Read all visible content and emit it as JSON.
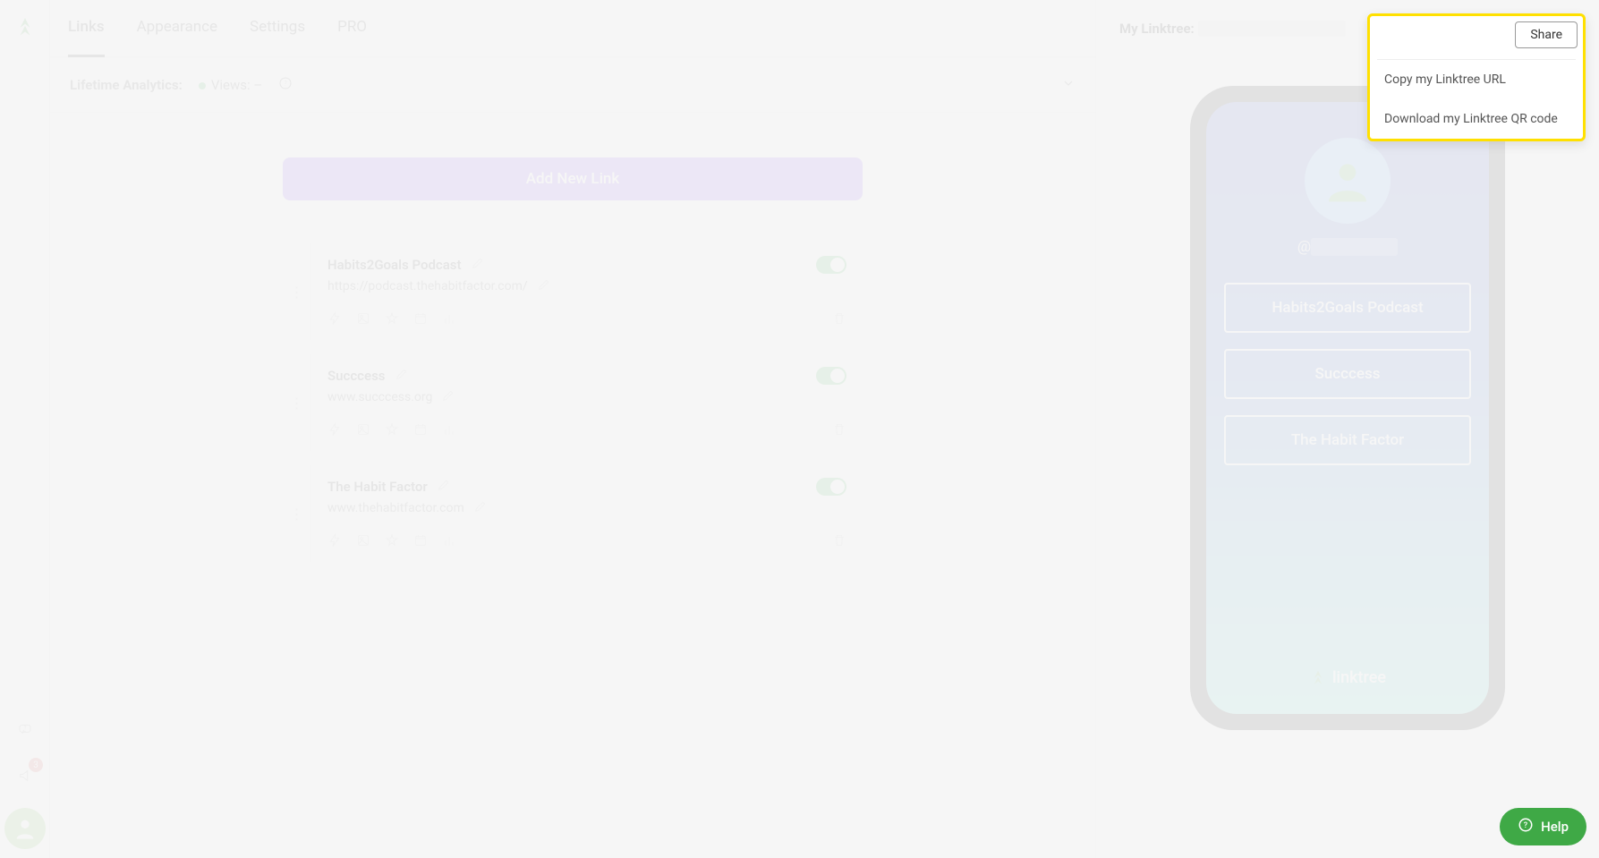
{
  "tabs": {
    "links": "Links",
    "appearance": "Appearance",
    "settings": "Settings",
    "pro": "PRO"
  },
  "analytics": {
    "label": "Lifetime Analytics:",
    "views_label": "Views: –"
  },
  "add_button": "Add New Link",
  "links": [
    {
      "title": "Habits2Goals Podcast",
      "url": "https://podcast.thehabitfactor.com/"
    },
    {
      "title": "Succcess",
      "url": "www.succcess.org"
    },
    {
      "title": "The Habit Factor",
      "url": "www.thehabitfactor.com"
    }
  ],
  "preview_header": {
    "label": "My Linktree:"
  },
  "phone": {
    "username_prefix": "@",
    "links": [
      "Habits2Goals Podcast",
      "Succcess",
      "The Habit Factor"
    ],
    "brand": "linktree"
  },
  "share_dropdown": {
    "button": "Share",
    "item1": "Copy my Linktree URL",
    "item2": "Download my Linktree QR code"
  },
  "help": "Help",
  "notification_count": "3"
}
